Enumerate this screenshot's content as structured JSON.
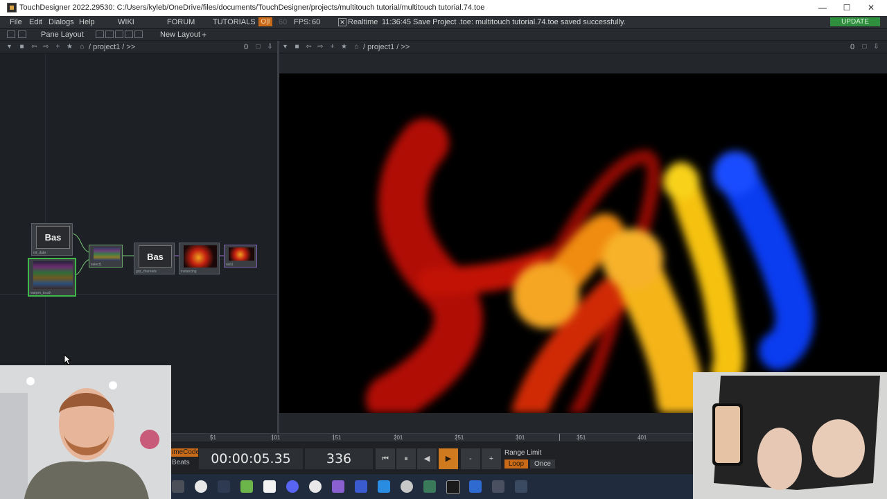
{
  "titlebar": {
    "title": "TouchDesigner 2022.29530: C:/Users/kyleb/OneDrive/files/documents/TouchDesigner/projects/multitouch tutorial/multitouch tutorial.74.toe",
    "minimize": "—",
    "maximize": "☐",
    "close": "✕"
  },
  "menubar": {
    "items": [
      "File",
      "Edit",
      "Dialogs",
      "Help"
    ],
    "wiki": "WIKI",
    "forum": "FORUM",
    "tutorials": "TUTORIALS",
    "o1": "O|I",
    "fps_dim": "60",
    "fps_label": "FPS:",
    "fps_value": "60",
    "realtime_check": "✕",
    "realtime": "Realtime",
    "status": "11:36:45 Save Project .toe: multitouch tutorial.74.toe saved successfully.",
    "update": "UPDATE"
  },
  "layoutbar": {
    "pane_layout": "Pane Layout",
    "new_layout": "New Layout",
    "add": "+"
  },
  "network_pane": {
    "path": "/ project1 / >>",
    "count": "0"
  },
  "viewer_pane": {
    "path": "/ project1 / >>",
    "count": "0"
  },
  "nodes": [
    {
      "name": "mt_data",
      "thumb": "Bas"
    },
    {
      "name": "warpm_touch",
      "thumb": ""
    },
    {
      "name": "select1",
      "thumb": ""
    },
    {
      "name": "grp_channels",
      "thumb": "Bas"
    },
    {
      "name": "instancing",
      "thumb": ""
    },
    {
      "name": "null1",
      "thumb": ""
    }
  ],
  "timeline": {
    "ticks": [
      "51",
      "101",
      "151",
      "201",
      "251",
      "301",
      "351",
      "401"
    ],
    "timecode_label": "imeCode",
    "beats_label": "Beats",
    "timecode": "00:00:05.35",
    "frame": "336",
    "range_limit": "Range Limit",
    "loop": "Loop",
    "once": "Once",
    "btn_start": "⏮",
    "btn_pause": "⏸",
    "btn_back": "◀",
    "btn_play": "▶",
    "btn_minus": "-",
    "btn_plus": "+"
  },
  "taskbar": {
    "apps": [
      "touchdesigner-icon",
      "obs-icon",
      "app-icon",
      "minecraft-icon",
      "notion-icon",
      "discord-icon",
      "slack-icon",
      "visual-studio-icon",
      "vscode-icon",
      "chrome-icon",
      "app2-icon",
      "terminal-icon",
      "app3-icon",
      "app4-icon",
      "share-icon"
    ]
  },
  "colors": {
    "accent_orange": "#c86a18",
    "update_green": "#2f8f3e",
    "taskbar": "#202b3d"
  }
}
